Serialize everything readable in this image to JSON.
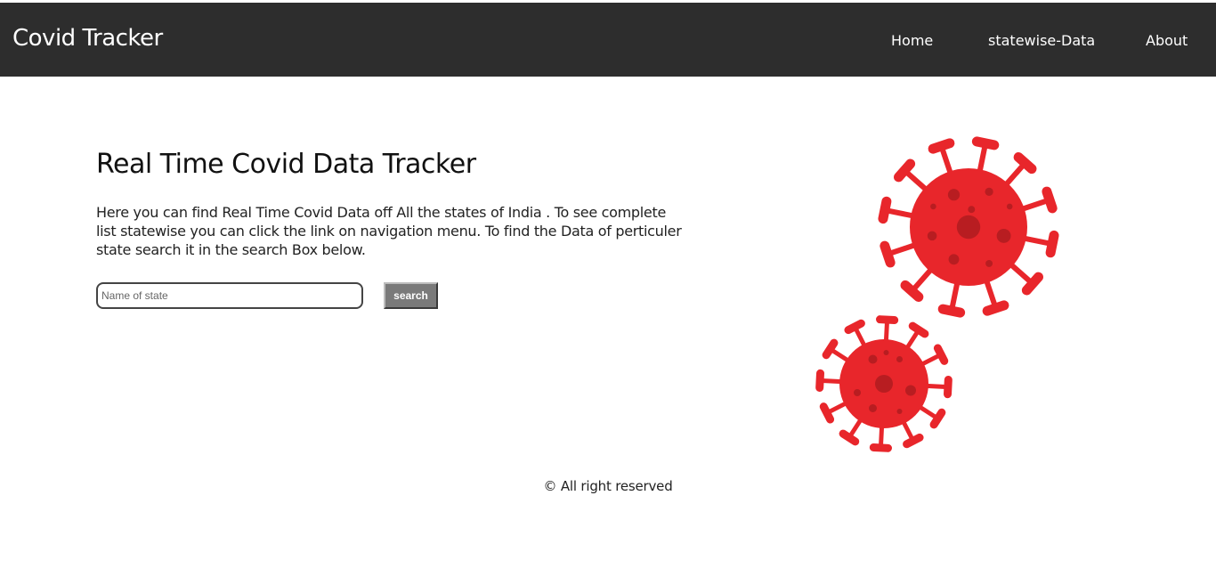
{
  "nav": {
    "brand": "Covid Tracker",
    "links": [
      "Home",
      "statewise-Data",
      "About"
    ]
  },
  "hero": {
    "title": "Real Time Covid Data Tracker",
    "description": "Here you can find Real Time Covid Data off All the states of India . To see complete list statewise you can click the link on navigation menu. To find the Data of perticuler state search it in the search Box below."
  },
  "search": {
    "placeholder": "Name of state",
    "value": "",
    "button_label": "search"
  },
  "illustration": {
    "name": "coronavirus-illustration",
    "color": "#e8262b",
    "dark_color": "#b81d21"
  },
  "footer": {
    "text": "© All right reserved"
  },
  "colors": {
    "navbar_bg": "#2d2d2d",
    "button_bg": "#7a7a7a"
  }
}
